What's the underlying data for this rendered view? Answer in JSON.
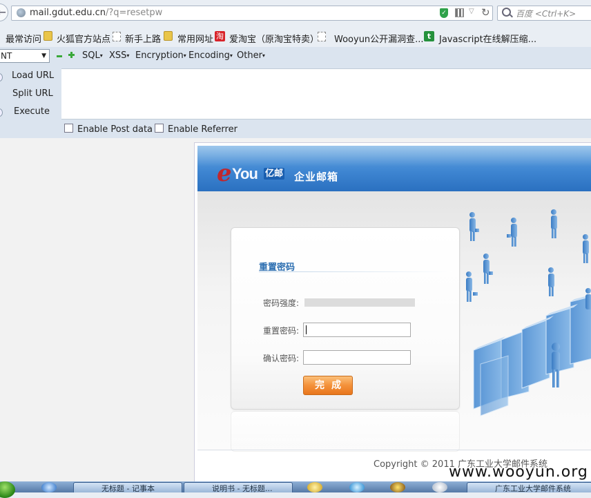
{
  "browser": {
    "url_host": "mail.gdut.edu.cn",
    "url_path": "/?q=resetpw",
    "search_placeholder": "百度 <Ctrl+K>"
  },
  "bookmarks": [
    {
      "label": "最常访问",
      "icon": "page-icon"
    },
    {
      "label": "火狐官方站点",
      "icon": "folder-icon"
    },
    {
      "label": "新手上路",
      "icon": "page-icon"
    },
    {
      "label": "常用网址",
      "icon": "folder-icon"
    },
    {
      "label": "爱淘宝（原淘宝特卖）",
      "icon": "taobao-icon"
    },
    {
      "label": "Wooyun公开漏洞查...",
      "icon": "page-icon"
    },
    {
      "label": "Javascript在线解压缩...",
      "icon": "t-icon"
    }
  ],
  "hackbar": {
    "select_value": "NT",
    "menus": [
      "SQL",
      "XSS",
      "Encryption",
      "Encoding",
      "Other"
    ],
    "load_url": "Load URL",
    "split_url": "Split URL",
    "execute": "Execute",
    "enable_post": "Enable Post data",
    "enable_referrer": "Enable Referrer",
    "taobao_glyph": "淘",
    "t_glyph": "t"
  },
  "page": {
    "logo_e": "e",
    "logo_you": "You",
    "logo_cn": "亿邮",
    "banner_title": "企业邮箱",
    "form_title": "重置密码",
    "strength_label": "密码强度:",
    "new_password_label": "重置密码:",
    "confirm_password_label": "确认密码:",
    "new_password_value": "",
    "confirm_password_value": "",
    "submit_label": "完成",
    "copyright": "Copyright © 2011 广东工业大学邮件系统"
  },
  "taskbar": {
    "buttons": [
      "无标题 - 记事本",
      "说明书 - 无标题...",
      "广东工业大学邮件系统"
    ]
  },
  "watermark": "www.wooyun.org"
}
